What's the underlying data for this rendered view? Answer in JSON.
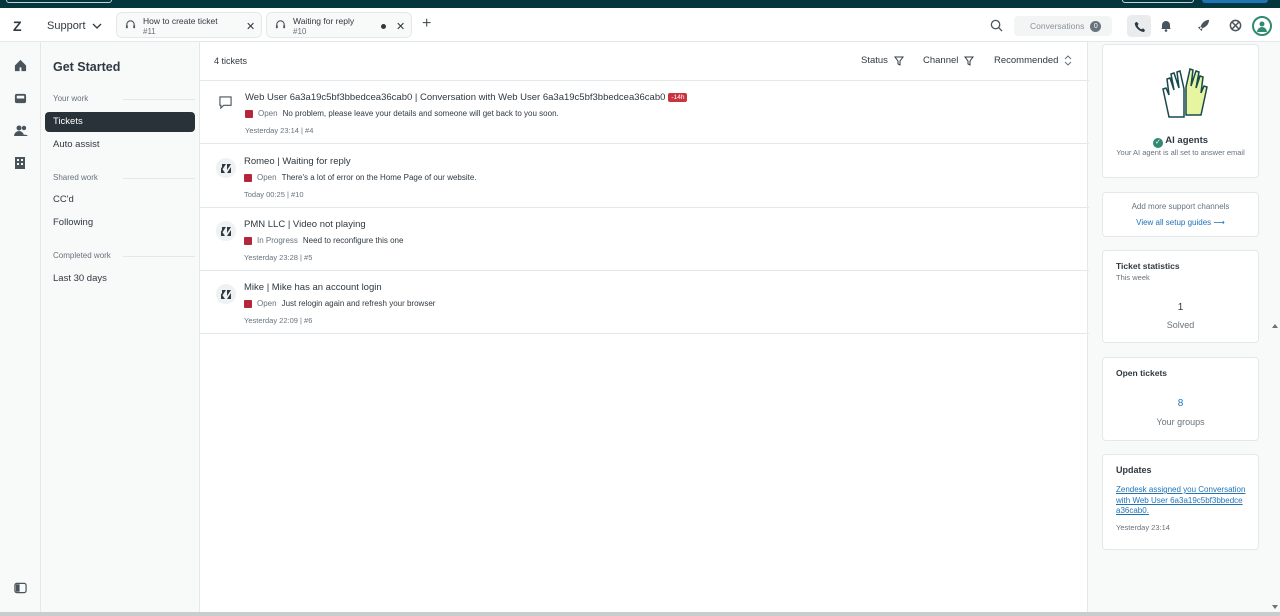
{
  "topbar": {
    "logo": "Z",
    "product": "Support",
    "tabs": [
      {
        "title": "How to create ticket",
        "sub": "#11"
      },
      {
        "title": "Waiting for reply",
        "sub": "#10"
      }
    ],
    "conversations_label": "Conversations",
    "conversations_count": "0"
  },
  "leftnav": {
    "title": "Get Started",
    "sections": [
      {
        "label": "Your work",
        "items": [
          "Tickets",
          "Auto assist"
        ]
      },
      {
        "label": "Shared work",
        "items": [
          "CC'd",
          "Following"
        ]
      },
      {
        "label": "Completed work",
        "items": [
          "Last 30 days"
        ]
      }
    ],
    "active_item": "Tickets"
  },
  "main": {
    "count": "4 tickets",
    "filters": {
      "status": "Status",
      "channel": "Channel",
      "sort": "Recommended"
    },
    "tickets": [
      {
        "title": "Web User 6a3a19c5bf3bbedcea36cab0 | Conversation with Web User 6a3a19c5bf3bbedcea36cab0",
        "badge": "-14h",
        "status": "Open",
        "snippet": "No problem, please leave your details and someone will get back to you soon.",
        "meta": "Yesterday 23:14 | #4",
        "icon": "chat-bubble-icon"
      },
      {
        "title": "Romeo | Waiting for reply",
        "badge": "",
        "status": "Open",
        "snippet": "There's a lot of error on the Home Page of our website.",
        "meta": "Today 00:25 | #10",
        "icon": "zendesk-icon"
      },
      {
        "title": "PMN LLC | Video not playing",
        "badge": "",
        "status": "In Progress",
        "snippet": "Need to reconfigure this one",
        "meta": "Yesterday 23:28 | #5",
        "icon": "zendesk-icon"
      },
      {
        "title": "Mike | Mike has an account login",
        "badge": "",
        "status": "Open",
        "snippet": "Just relogin again and refresh your browser",
        "meta": "Yesterday 22:09 | #6",
        "icon": "zendesk-icon"
      }
    ]
  },
  "right": {
    "ai": {
      "title": "AI agents",
      "desc": "Your AI agent is all set to answer email"
    },
    "channels": {
      "title": "Add more support channels",
      "link": "View all setup guides"
    },
    "stats": {
      "title": "Ticket statistics",
      "sub": "This week",
      "value": "1",
      "label": "Solved"
    },
    "open": {
      "title": "Open tickets",
      "value": "8",
      "label": "Your groups"
    },
    "updates": {
      "title": "Updates",
      "link": "Zendesk assigned you Conversation with Web User 6a3a19c5bf3bbedcea36cab0.",
      "time": "Yesterday 23:14"
    }
  },
  "colors": {
    "accent_dark": "#03363d",
    "status_red": "#b3263c",
    "badge_red": "#cc3340",
    "link_blue": "#1f73b7",
    "green": "#2f8a6f"
  }
}
